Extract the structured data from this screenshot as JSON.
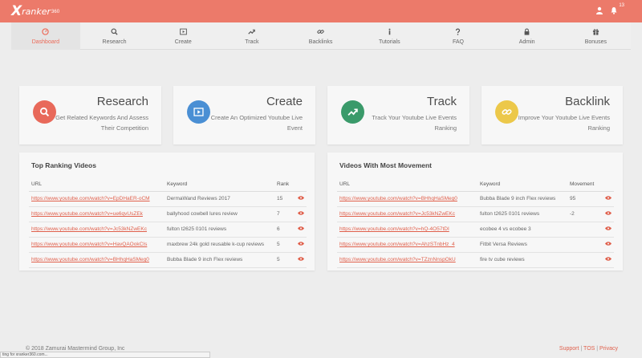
{
  "header": {
    "logo_x": "X",
    "logo_word": "ranker",
    "logo_num": "360",
    "notification_count": "13"
  },
  "nav": [
    {
      "label": "Dashboard",
      "icon": "dashboard-icon",
      "active": true
    },
    {
      "label": "Research",
      "icon": "search-icon"
    },
    {
      "label": "Create",
      "icon": "play-icon"
    },
    {
      "label": "Track",
      "icon": "trend-icon"
    },
    {
      "label": "Backlinks",
      "icon": "link-icon"
    },
    {
      "label": "Tutorials",
      "icon": "info-icon"
    },
    {
      "label": "FAQ",
      "icon": "question-icon"
    },
    {
      "label": "Admin",
      "icon": "lock-icon"
    },
    {
      "label": "Bonuses",
      "icon": "gift-icon"
    }
  ],
  "cards": [
    {
      "title": "Research",
      "desc": "Get Related Keywords And Assess Their Competition",
      "color": "#e8695a",
      "icon": "search-icon"
    },
    {
      "title": "Create",
      "desc": "Create An Optimized Youtube Live Event",
      "color": "#4a8fd4",
      "icon": "play-icon"
    },
    {
      "title": "Track",
      "desc": "Track Your Youtube Live Events Ranking",
      "color": "#3a9a6a",
      "icon": "trend-icon"
    },
    {
      "title": "Backlink",
      "desc": "Improve Your Youtube Live Events Ranking",
      "color": "#ecc84a",
      "icon": "link-icon"
    }
  ],
  "top_ranking": {
    "title": "Top Ranking Videos",
    "headers": [
      "URL",
      "Keyword",
      "Rank"
    ],
    "rows": [
      {
        "url": "https://www.youtube.com/watch?v=EpDHaER-oCM",
        "keyword": "DermaWand Reviews 2017",
        "value": "15"
      },
      {
        "url": "https://www.youtube.com/watch?v=ue6qvUsZEk",
        "keyword": "ballyhood cowbell lures review",
        "value": "7"
      },
      {
        "url": "https://www.youtube.com/watch?v=Jc53kNZwEKc",
        "keyword": "fulton t2625 0101 reviews",
        "value": "6"
      },
      {
        "url": "https://www.youtube.com/watch?v=HavQAOokCIs",
        "keyword": "maxbrew 24k gold reusable k-cup reviews",
        "value": "5"
      },
      {
        "url": "https://www.youtube.com/watch?v=BHhqHaSMeg0",
        "keyword": "Bubba Blade 9 inch Flex reviews",
        "value": "5"
      }
    ]
  },
  "most_movement": {
    "title": "Videos With Most Movement",
    "headers": [
      "URL",
      "Keyword",
      "Movement"
    ],
    "rows": [
      {
        "url": "https://www.youtube.com/watch?v=BHhqHaSMeg0",
        "keyword": "Bubba Blade 9 inch Flex reviews",
        "value": "95"
      },
      {
        "url": "https://www.youtube.com/watch?v=Jc53kNZwEKc",
        "keyword": "fulton t2625 0101 reviews",
        "value": "-2"
      },
      {
        "url": "https://www.youtube.com/watch?v=hQ-4O57tDI",
        "keyword": "ecobee 4 vs ecobee 3",
        "value": ""
      },
      {
        "url": "https://www.youtube.com/watch?v=AhzSTnbHz_4",
        "keyword": "Fitbit Versa Reviews",
        "value": ""
      },
      {
        "url": "https://www.youtube.com/watch?v=TZznNnspOkU",
        "keyword": "fire tv cube reviews",
        "value": ""
      }
    ]
  },
  "footer": {
    "copyright": "© 2018 Zamurai Mastermind Group, Inc",
    "support": "Support",
    "tos": "TOS",
    "privacy": "Privacy",
    "sep": "|"
  },
  "status": "ting for xranker360.com..."
}
